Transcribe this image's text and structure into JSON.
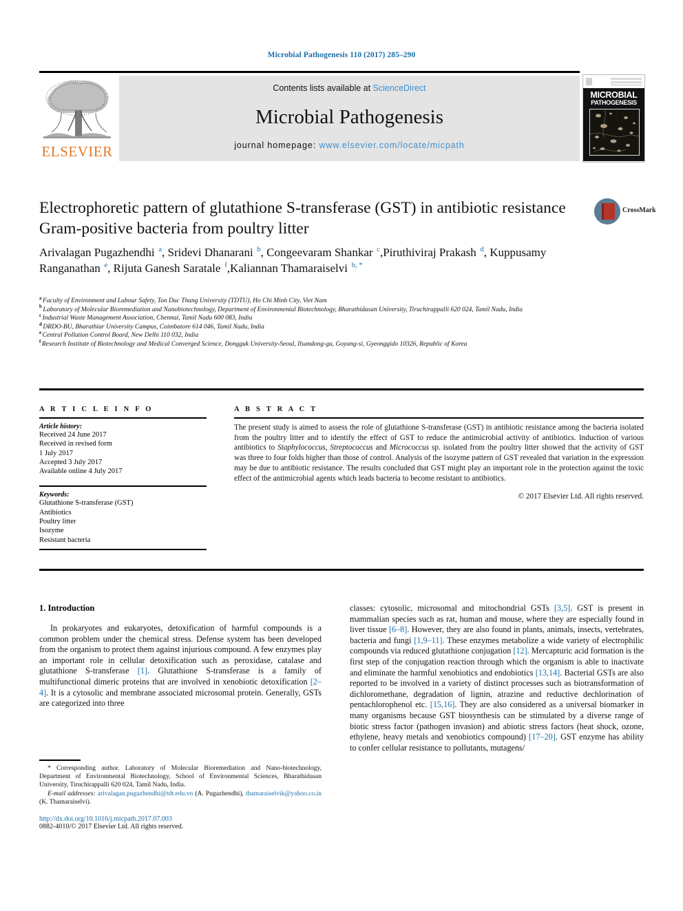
{
  "running_head": "Microbial Pathogenesis 110 (2017) 285–290",
  "masthead": {
    "contents_prefix": "Contents lists available at ",
    "sciencedirect": "ScienceDirect",
    "journal_title": "Microbial Pathogenesis",
    "homepage_prefix": "journal homepage: ",
    "homepage_url": "www.elsevier.com/locate/micpath",
    "publisher_name": "ELSEVIER",
    "publisher_logo_icon": "elsevier-tree-icon",
    "cover_line1": "MICROBIAL",
    "cover_line2": "PATHOGENESIS",
    "colors": {
      "link_blue": "#3f8fcf",
      "elsevier_orange": "#e87722",
      "band_grey": "#e4e4e4"
    }
  },
  "crossmark": {
    "label": "CrossMark",
    "icon": "crossmark-icon"
  },
  "article": {
    "title": "Electrophoretic pattern of glutathione S-transferase (GST) in antibiotic resistance Gram-positive bacteria from poultry litter",
    "authors": [
      {
        "name": "Arivalagan Pugazhendhi",
        "sup": "a",
        "sep": ", "
      },
      {
        "name": "Sridevi Dhanarani",
        "sup": "b",
        "sep": ", "
      },
      {
        "name": "Congeevaram Shankar",
        "sup": "c",
        "sep": ","
      },
      {
        "name": "Piruthiviraj Prakash",
        "sup": "d",
        "sep": ", "
      },
      {
        "name": "Kuppusamy Ranganathan",
        "sup": "e",
        "sep": ", "
      },
      {
        "name": "Rijuta Ganesh Saratale",
        "sup": "f",
        "sep": ","
      },
      {
        "name": "Kaliannan Thamaraiselvi",
        "sup": "b, *",
        "sep": ""
      }
    ],
    "affiliations": [
      {
        "mark": "a",
        "text": "Faculty of Environment and Labour Safety, Ton Duc Thang University (TDTU), Ho Chi Minh City, Viet Nam"
      },
      {
        "mark": "b",
        "text": "Laboratory of Molecular Bioremediation and Nanobiotechnology, Department of Environmental Biotechnology, Bharathidasan University, Tiruchirappalli 620 024, Tamil Nadu, India"
      },
      {
        "mark": "c",
        "text": "Industrial Waste Management Association, Chennai, Tamil Nadu 600 083, India"
      },
      {
        "mark": "d",
        "text": "DRDO-BU, Bharathiar University Campus, Coimbatore 614 046, Tamil Nadu, India"
      },
      {
        "mark": "e",
        "text": "Central Pollution Control Board, New Delhi 110 032, India"
      },
      {
        "mark": "f",
        "text": "Research Institute of Biotechnology and Medical Converged Science, Dongguk University-Seoul, Ilsandong-gu, Goyang-si, Gyeonggido 10326, Republic of Korea"
      }
    ]
  },
  "article_info": {
    "heading": "A R T I C L E   I N F O",
    "history_label": "Article history:",
    "history": [
      "Received 24 June 2017",
      "Received in revised form",
      "1 July 2017",
      "Accepted 3 July 2017",
      "Available online 4 July 2017"
    ],
    "keywords_label": "Keywords:",
    "keywords": [
      "Glutathione S-transferase (GST)",
      "Antibiotics",
      "Poultry litter",
      "Isozyme",
      "Resistant bacteria"
    ]
  },
  "abstract": {
    "heading": "A B S T R A C T",
    "part1": "The present study is aimed to assess the role of glutathione S-transferase (GST) in antibiotic resistance among the bacteria isolated from the poultry litter and to identify the effect of GST to reduce the antimicrobial activity of antibiotics. Induction of various antibiotics to ",
    "italic1": "Staphylococcus",
    "part2": ", ",
    "italic2": "Streptococcus",
    "part3": " and ",
    "italic3": "Micrococcus",
    "part4": " sp. isolated from the poultry litter showed that the activity of GST was three to four folds higher than those of control. Analysis of the isozyme pattern of GST revealed that variation in the expression may be due to antibiotic resistance. The results concluded that GST might play an important role in the protection against the toxic effect of the antimicrobial agents which leads bacteria to become resistant to antibiotics.",
    "copyright": "© 2017 Elsevier Ltd. All rights reserved."
  },
  "introduction": {
    "heading": "1. Introduction",
    "left_paragraph": {
      "t1": "In prokaryotes and eukaryotes, detoxification of harmful compounds is a common problem under the chemical stress. Defense system has been developed from the organism to protect them against injurious compound. A few enzymes play an important role in cellular detoxification such as peroxidase, catalase and glutathione S-transferase ",
      "r1": "[1]",
      "t2": ". Glutathione S-transferase is a family of multifunctional dimeric proteins that are involved in xenobiotic detoxification ",
      "r2": "[2–4]",
      "t3": ". It is a cytosolic and membrane associated microsomal protein. Generally, GSTs are categorized into three"
    },
    "right_paragraph": {
      "t1": "classes: cytosolic, microsomal and mitochondrial GSTs ",
      "r1": "[3,5]",
      "t2": ". GST is present in mammalian species such as rat, human and mouse, where they are especially found in liver tissue ",
      "r2": "[6–8]",
      "t3": ". However, they are also found in plants, animals, insects, vertebrates, bacteria and fungi ",
      "r3": "[1,9–11]",
      "t4": ". These enzymes metabolize a wide variety of electrophilic compounds via reduced glutathione conjugation ",
      "r4": "[12]",
      "t5": ". Mercapturic acid formation is the first step of the conjugation reaction through which the organism is able to inactivate and eliminate the harmful xenobiotics and endobiotics ",
      "r5": "[13,14]",
      "t6": ". Bacterial GSTs are also reported to be involved in a variety of distinct processes such as biotransformation of dichloromethane, degradation of lignin, atrazine and reductive dechlorination of pentachlorophenol etc. ",
      "r6": "[15,16]",
      "t7": ". They are also considered as a universal biomarker in many organisms because GST biosynthesis can be stimulated by a diverse range of biotic stress factor (pathogen invasion) and abiotic stress factors (heat shock, ozone, ethylene, heavy metals and xenobiotics compound) ",
      "r7": "[17–20]",
      "t8": ". GST enzyme has ability to confer cellular resistance to pollutants, mutagens/"
    }
  },
  "footnote": {
    "corresponding_marker": "*",
    "corresponding_text": " Corresponding author. Laboratory of Molecular Bioremediation and Nano-biotechnology, Department of Environmental Biotechnology, School of Environmental Sciences, Bharathidasan University, Tiruchirappalli 620 024, Tamil Nadu, India.",
    "email_label": "E-mail addresses:",
    "email1": "arivalagan.pugazhendhi@tdt.edu.vn",
    "email1_owner": " (A. Pugazhendhi), ",
    "email2": "thamaraiselvik@yahoo.co.in",
    "email2_owner": " (K. Thamaraiselvi).",
    "doi": "http://dx.doi.org/10.1016/j.micpath.2017.07.003",
    "issn_line": "0882-4010/© 2017 Elsevier Ltd. All rights reserved."
  }
}
